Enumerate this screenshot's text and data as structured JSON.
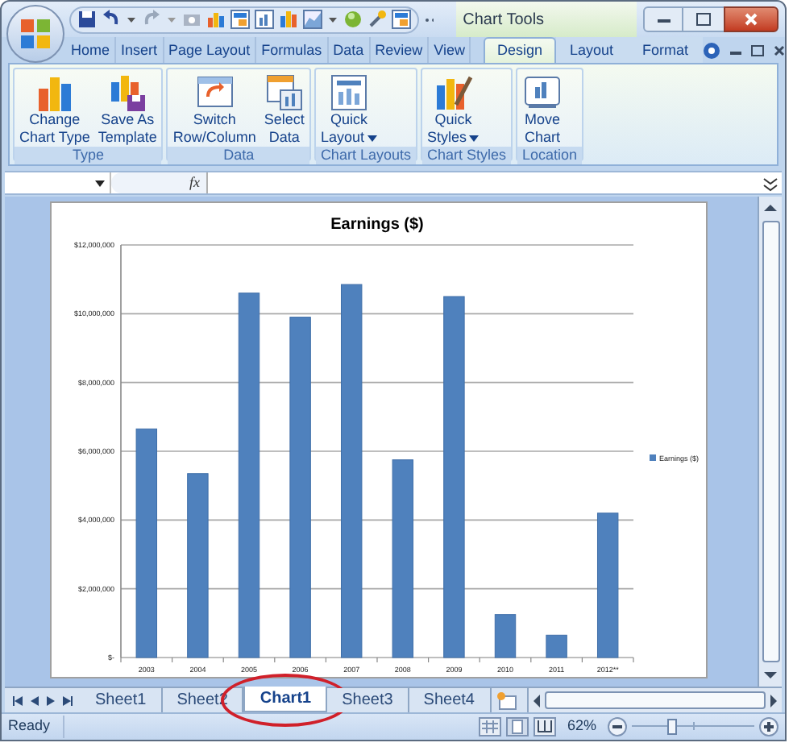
{
  "window": {
    "context_title": "Chart Tools"
  },
  "tabs": [
    {
      "label": "Home",
      "selected": false,
      "contextual": false
    },
    {
      "label": "Insert",
      "selected": false,
      "contextual": false
    },
    {
      "label": "Page Layout",
      "selected": false,
      "contextual": false
    },
    {
      "label": "Formulas",
      "selected": false,
      "contextual": false
    },
    {
      "label": "Data",
      "selected": false,
      "contextual": false
    },
    {
      "label": "Review",
      "selected": false,
      "contextual": false
    },
    {
      "label": "View",
      "selected": false,
      "contextual": false
    },
    {
      "label": "Design",
      "selected": true,
      "contextual": true
    },
    {
      "label": "Layout",
      "selected": false,
      "contextual": true
    },
    {
      "label": "Format",
      "selected": false,
      "contextual": true
    }
  ],
  "ribbon_groups": [
    {
      "label": "Type",
      "buttons": [
        {
          "lines": [
            "Change",
            "Chart Type"
          ],
          "dropdown": false
        },
        {
          "lines": [
            "Save As",
            "Template"
          ],
          "dropdown": false
        }
      ]
    },
    {
      "label": "Data",
      "buttons": [
        {
          "lines": [
            "Switch",
            "Row/Column"
          ],
          "dropdown": false
        },
        {
          "lines": [
            "Select",
            "Data"
          ],
          "dropdown": false
        }
      ]
    },
    {
      "label": "Chart Layouts",
      "buttons": [
        {
          "lines": [
            "Quick",
            "Layout"
          ],
          "dropdown": true
        }
      ]
    },
    {
      "label": "Chart Styles",
      "buttons": [
        {
          "lines": [
            "Quick",
            "Styles"
          ],
          "dropdown": true
        }
      ]
    },
    {
      "label": "Location",
      "buttons": [
        {
          "lines": [
            "Move",
            "Chart"
          ],
          "dropdown": false
        }
      ]
    }
  ],
  "formula_bar": {
    "function_label": "fx"
  },
  "chart_data": {
    "type": "bar",
    "title": "Earnings ($)",
    "categories": [
      "2003",
      "2004",
      "2005",
      "2006",
      "2007",
      "2008",
      "2009",
      "2010",
      "2011",
      "2012**"
    ],
    "series": [
      {
        "name": "Earnings ($)",
        "color": "#4f81bd",
        "values": [
          6650000,
          5350000,
          10600000,
          9900000,
          10850000,
          5750000,
          10500000,
          1250000,
          650000,
          4200000
        ]
      }
    ],
    "ylim": [
      0,
      12000000
    ],
    "grid": true,
    "yticks": [
      {
        "value": 0,
        "label": "$-"
      },
      {
        "value": 2000000,
        "label": "$2,000,000"
      },
      {
        "value": 4000000,
        "label": "$4,000,000"
      },
      {
        "value": 6000000,
        "label": "$6,000,000"
      },
      {
        "value": 8000000,
        "label": "$8,000,000"
      },
      {
        "value": 10000000,
        "label": "$10,000,000"
      },
      {
        "value": 12000000,
        "label": "$12,000,000"
      }
    ]
  },
  "sheet_tabs": [
    {
      "label": "Sheet1",
      "selected": false,
      "circled": false
    },
    {
      "label": "Sheet2",
      "selected": false,
      "circled": false
    },
    {
      "label": "Chart1",
      "selected": true,
      "circled": true
    },
    {
      "label": "Sheet3",
      "selected": false,
      "circled": false
    },
    {
      "label": "Sheet4",
      "selected": false,
      "circled": false
    }
  ],
  "status_bar": {
    "status": "Ready",
    "zoom": "62%",
    "zoom_slider": {
      "level": 0.31
    }
  }
}
